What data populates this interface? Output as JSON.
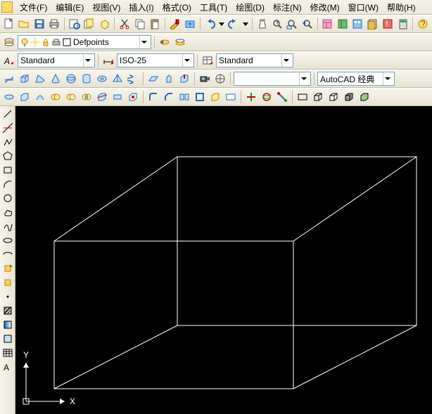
{
  "menu": {
    "file": "文件(F)",
    "edit": "编辑(E)",
    "view": "视图(V)",
    "insert": "插入(I)",
    "format": "格式(O)",
    "tools": "工具(T)",
    "draw": "绘图(D)",
    "dimension": "标注(N)",
    "modify": "修改(M)",
    "window": "窗口(W)",
    "help": "帮助(H)"
  },
  "layer": {
    "name": "Defpoints"
  },
  "textstyle": {
    "name": "Standard"
  },
  "dimstyle": {
    "name": "ISO-25"
  },
  "tablestyle": {
    "name": "Standard"
  },
  "workspace": {
    "name": "AutoCAD 经典"
  },
  "ucs": {
    "x": "X",
    "y": "Y"
  }
}
